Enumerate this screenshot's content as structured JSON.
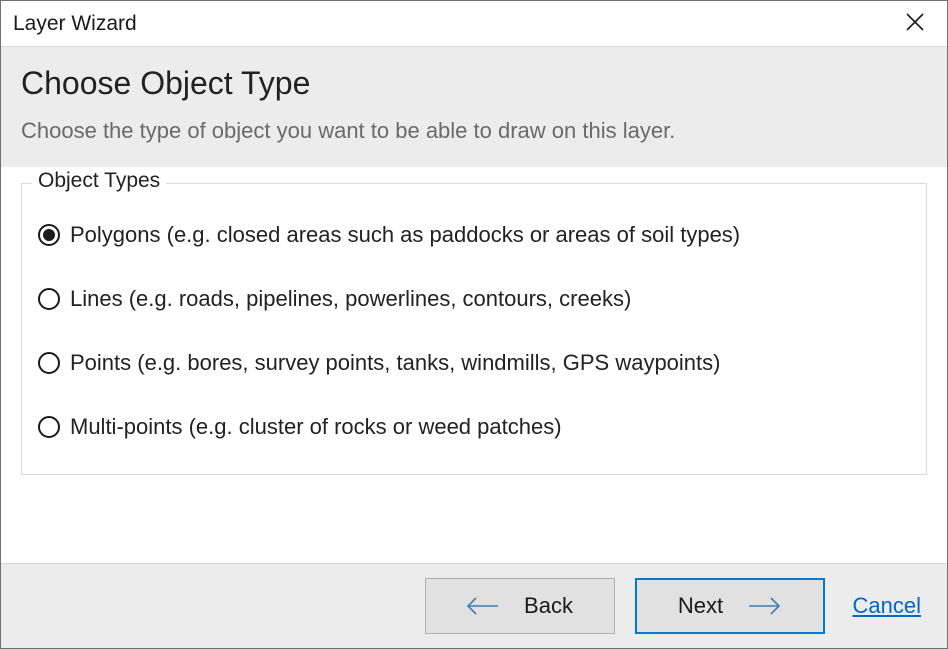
{
  "window": {
    "title": "Layer Wizard"
  },
  "header": {
    "heading": "Choose Object Type",
    "subtitle": "Choose the type of object you want to be able to draw on this layer."
  },
  "fieldset": {
    "legend": "Object Types",
    "options": [
      {
        "label": "Polygons (e.g. closed areas such as paddocks or areas of soil types)",
        "selected": true
      },
      {
        "label": "Lines (e.g. roads, pipelines, powerlines, contours, creeks)",
        "selected": false
      },
      {
        "label": "Points (e.g. bores, survey points, tanks, windmills, GPS waypoints)",
        "selected": false
      },
      {
        "label": "Multi-points (e.g. cluster of rocks or weed patches)",
        "selected": false
      }
    ]
  },
  "footer": {
    "back": "Back",
    "next": "Next",
    "cancel": "Cancel"
  }
}
